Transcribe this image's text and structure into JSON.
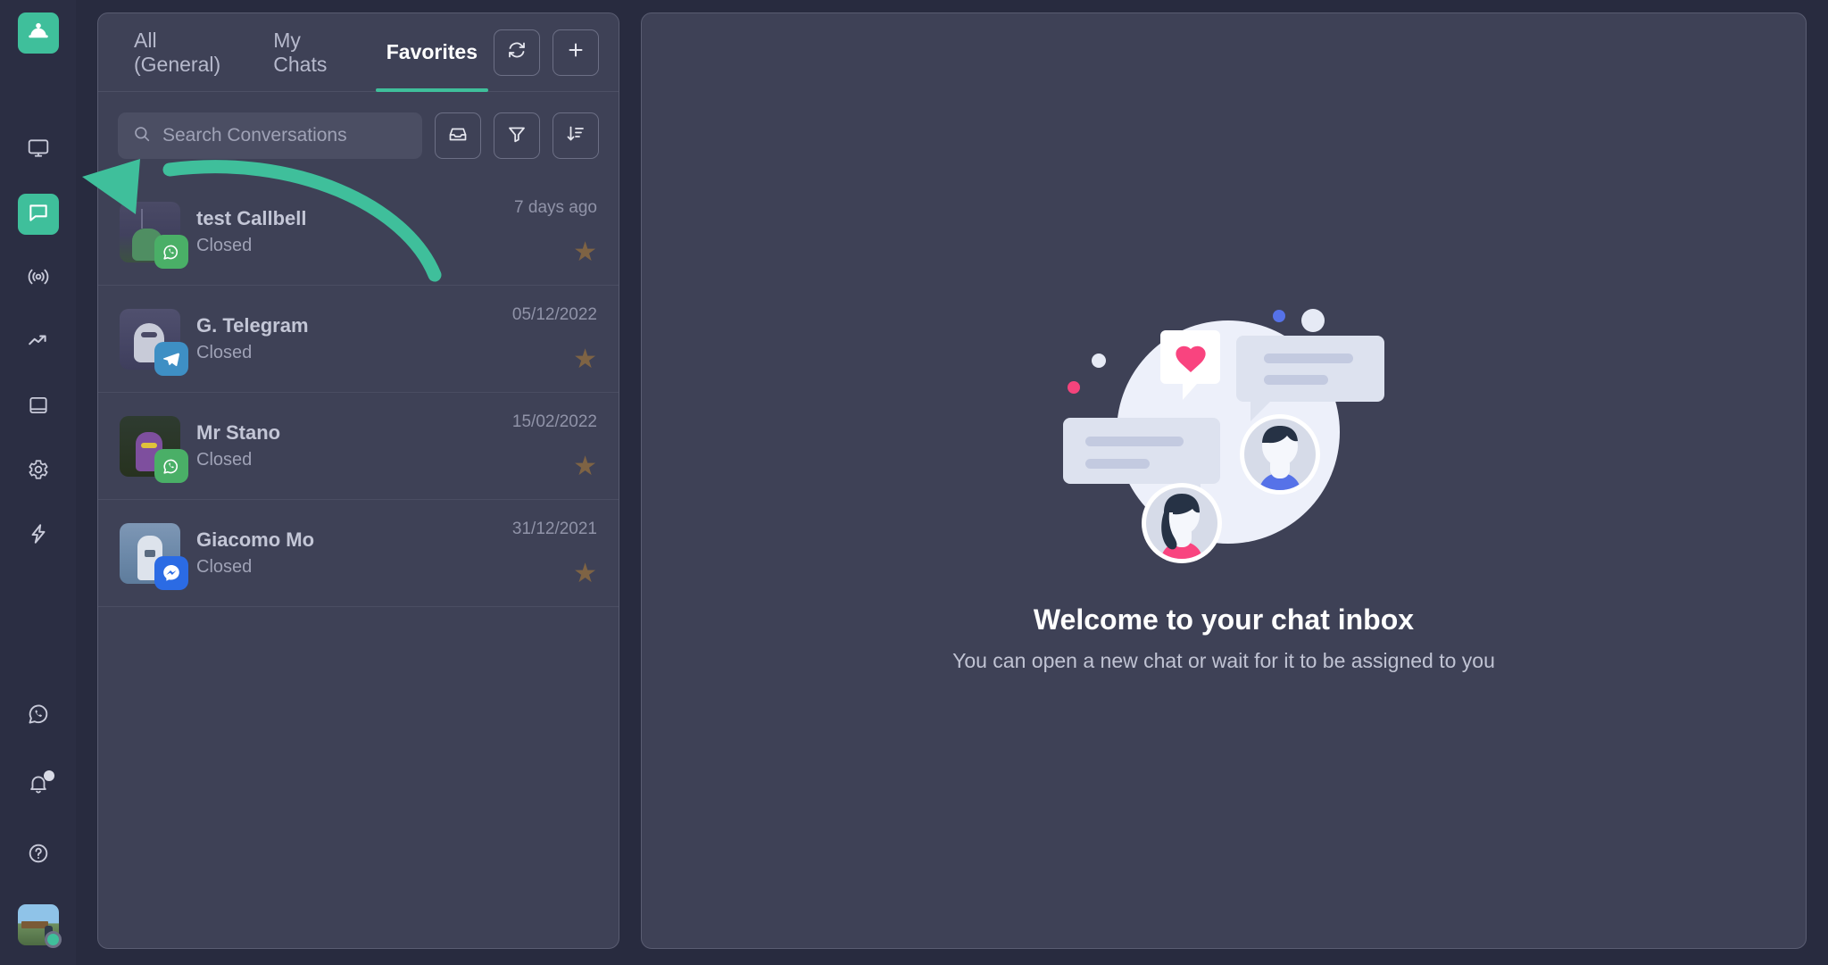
{
  "sidebar": {
    "logo_icon": "service-bell-icon",
    "items": [
      {
        "icon": "monitor-icon",
        "name": "dashboard",
        "active": false
      },
      {
        "icon": "chat-bubble-icon",
        "name": "chats",
        "active": true
      },
      {
        "icon": "broadcast-icon",
        "name": "broadcast",
        "active": false
      },
      {
        "icon": "trending-up-icon",
        "name": "analytics",
        "active": false
      },
      {
        "icon": "book-icon",
        "name": "knowledge-base",
        "active": false
      },
      {
        "icon": "gear-icon",
        "name": "settings",
        "active": false
      },
      {
        "icon": "lightning-icon",
        "name": "automations",
        "active": false
      }
    ],
    "bottom_items": [
      {
        "icon": "whatsapp-icon",
        "name": "whatsapp"
      },
      {
        "icon": "bell-icon",
        "name": "notifications",
        "has_badge": true
      },
      {
        "icon": "help-circle-icon",
        "name": "help"
      }
    ],
    "account": {
      "name": "user-avatar",
      "status": "online",
      "status_color": "#3FBF9B"
    }
  },
  "conversations_panel": {
    "tabs": [
      {
        "label": "All (General)",
        "active": false
      },
      {
        "label": "My Chats",
        "active": false
      },
      {
        "label": "Favorites",
        "active": true
      }
    ],
    "header_buttons": [
      {
        "icon": "refresh-icon",
        "name": "refresh-button"
      },
      {
        "icon": "plus-icon",
        "name": "new-conversation-button"
      }
    ],
    "search": {
      "placeholder": "Search Conversations",
      "value": "",
      "icon": "search-icon"
    },
    "toolbar_buttons": [
      {
        "icon": "inbox-icon",
        "name": "inbox-button"
      },
      {
        "icon": "funnel-icon",
        "name": "filter-button"
      },
      {
        "icon": "sort-descending-icon",
        "name": "sort-button"
      }
    ],
    "items": [
      {
        "name": "test Callbell",
        "status": "Closed",
        "date": "7 days ago",
        "channel": "whatsapp",
        "favorite": true
      },
      {
        "name": "G. Telegram",
        "status": "Closed",
        "date": "05/12/2022",
        "channel": "telegram",
        "favorite": true
      },
      {
        "name": "Mr Stano",
        "status": "Closed",
        "date": "15/02/2022",
        "channel": "whatsapp",
        "favorite": true
      },
      {
        "name": "Giacomo Mo",
        "status": "Closed",
        "date": "31/12/2021",
        "channel": "messenger",
        "favorite": true
      }
    ]
  },
  "main": {
    "title": "Welcome to your chat inbox",
    "subtitle": "You can open a new chat or wait for it to be assigned to you",
    "illustration": "chat-inbox-empty-state-illustration"
  },
  "annotation": {
    "type": "curved-arrow",
    "color": "#3FBF9B",
    "points_to": "left-sidebar"
  },
  "colors": {
    "background": "#282B3F",
    "rail": "#2B2E43",
    "panel": "#3E4156",
    "accent": "#3FBF9B",
    "star": "#7E6344"
  }
}
